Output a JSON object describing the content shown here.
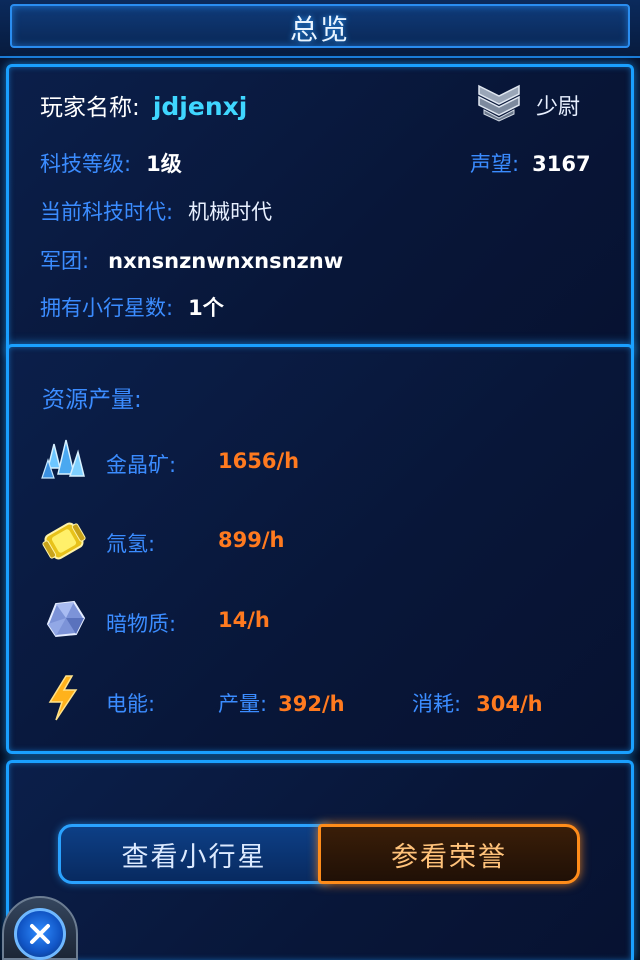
{
  "title": "总览",
  "player": {
    "name_label": "玩家名称:",
    "name": "jdjenxj",
    "rank": "少尉",
    "tech_level_label": "科技等级:",
    "tech_level": "1级",
    "prestige_label": "声望:",
    "prestige": "3167",
    "era_label": "当前科技时代:",
    "era": "机械时代",
    "legion_label": "军团:",
    "legion": "nxnsnznwnxnsnznw",
    "asteroids_label": "拥有小行星数:",
    "asteroids": "1个"
  },
  "resources": {
    "heading": "资源产量:",
    "items": [
      {
        "icon": "crystal-icon",
        "label": "金晶矿:",
        "value": "1656/h"
      },
      {
        "icon": "gas-canister-icon",
        "label": "氚氢:",
        "value": "899/h"
      },
      {
        "icon": "dark-matter-icon",
        "label": "暗物质:",
        "value": "14/h"
      }
    ],
    "energy": {
      "icon": "lightning-icon",
      "label": "电能:",
      "produce_label": "产量:",
      "produce": "392/h",
      "consume_label": "消耗:",
      "consume": "304/h"
    }
  },
  "buttons": {
    "view_asteroids": "查看小行星",
    "view_honor": "参看荣誉"
  },
  "colors": {
    "accent_blue": "#1aa0ff",
    "label_blue": "#3b8cff",
    "value_orange": "#ff7a1f",
    "name_cyan": "#3fd6ff"
  }
}
